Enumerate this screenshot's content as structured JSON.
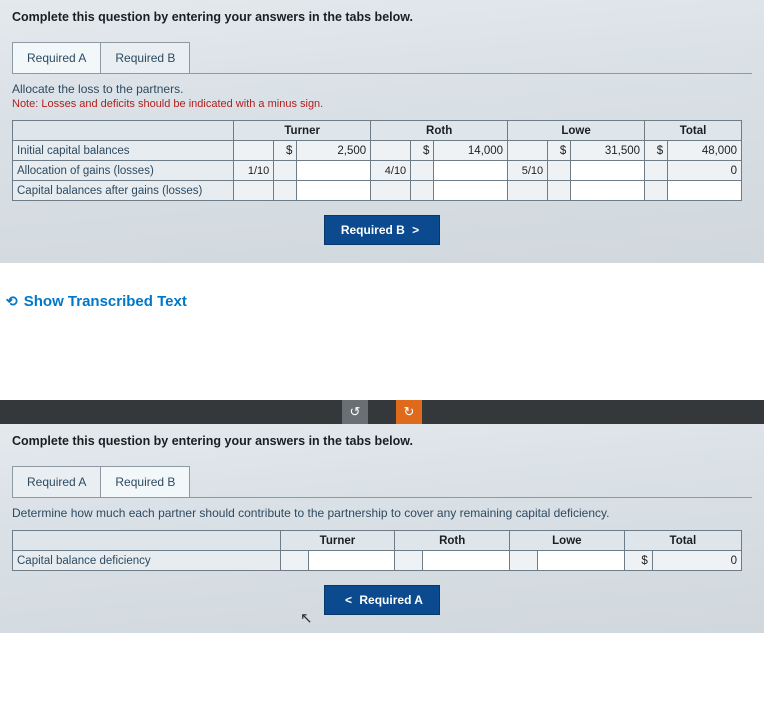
{
  "shared": {
    "instruction": "Complete this question by entering your answers in the tabs below.",
    "tabA": "Required A",
    "tabB": "Required B",
    "colTurner": "Turner",
    "colRoth": "Roth",
    "colLowe": "Lowe",
    "colTotal": "Total",
    "sym": "$"
  },
  "top": {
    "prompt": "Allocate the loss to the partners.",
    "note": "Note: Losses and deficits should be indicated with a minus sign.",
    "rows": {
      "r1": "Initial capital balances",
      "r2": "Allocation of gains (losses)",
      "r3": "Capital balances after gains (losses)"
    },
    "vals": {
      "turner_init": "2,500",
      "roth_init": "14,000",
      "lowe_init": "31,500",
      "total_init": "48,000",
      "frac_turner": "1/10",
      "frac_roth": "4/10",
      "frac_lowe": "5/10",
      "total_alloc": "0"
    },
    "navBtn": "Required B",
    "navChev": ">"
  },
  "transcribed": {
    "label": "Show Transcribed Text"
  },
  "midbar": {
    "undo": "↺",
    "redo": "↻"
  },
  "bottom": {
    "prompt": "Determine how much each partner should contribute to the partnership to cover any remaining capital deficiency.",
    "row": "Capital balance deficiency",
    "total_val": "0",
    "navBtn": "Required A",
    "navChev": "<"
  }
}
